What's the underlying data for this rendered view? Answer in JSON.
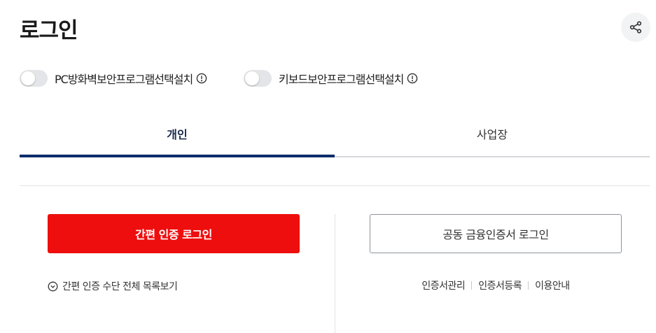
{
  "header": {
    "title": "로그인",
    "share_icon": "share-icon"
  },
  "toggles": [
    {
      "label": "PC방화벽보안프로그램선택설치",
      "checked": false,
      "icon": "info-icon"
    },
    {
      "label": "키보드보안프로그램선택설치",
      "checked": false,
      "icon": "info-icon"
    }
  ],
  "tabs": [
    {
      "label": "개인",
      "active": true
    },
    {
      "label": "사업장",
      "active": false
    }
  ],
  "personal": {
    "simple_login_label": "간편 인증 로그인",
    "simple_list_label": "간편 인증 수단 전체 목록보기",
    "cert_login_label": "공동 금융인증서 로그인",
    "cert_links": [
      "인증서관리",
      "인증서등록",
      "이용안내"
    ]
  },
  "colors": {
    "primary_red": "#ee0e0e",
    "tab_active": "#0b2d6b"
  }
}
